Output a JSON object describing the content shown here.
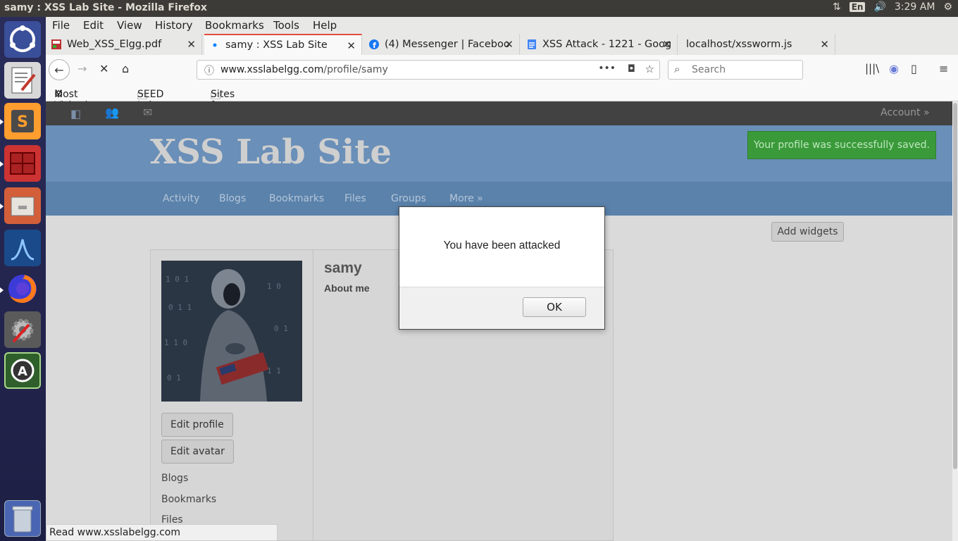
{
  "os": {
    "window_title": "samy : XSS Lab Site - Mozilla Firefox",
    "keyboard_layout": "En",
    "clock": "3:29 AM"
  },
  "menu": [
    "File",
    "Edit",
    "View",
    "History",
    "Bookmarks",
    "Tools",
    "Help"
  ],
  "tabs": [
    {
      "label": "Web_XSS_Elgg.pdf",
      "icon": "pdf-icon"
    },
    {
      "label": "samy : XSS Lab Site",
      "icon": "loading-dot-icon",
      "active": true
    },
    {
      "label": "(4) Messenger | Faceboo",
      "icon": "facebook-icon"
    },
    {
      "label": "XSS Attack - 1221 - Goog",
      "icon": "google-docs-icon"
    },
    {
      "label": "localhost/xssworm.js",
      "icon": ""
    }
  ],
  "navbar": {
    "url_host": "www.xsslabelgg.com",
    "url_path": "/profile/samy",
    "search_placeholder": "Search"
  },
  "bookmarks": [
    "Most Visited",
    "SEED Labs",
    "Sites for Labs"
  ],
  "site": {
    "account_label": "Account »",
    "name": "XSS Lab Site",
    "success_message": "Your profile was successfully saved.",
    "nav": [
      "Activity",
      "Blogs",
      "Bookmarks",
      "Files",
      "Groups",
      "More »"
    ],
    "add_widgets": "Add widgets",
    "profile": {
      "username": "samy",
      "about_heading": "About me",
      "edit_profile": "Edit profile",
      "edit_avatar": "Edit avatar",
      "links": [
        "Blogs",
        "Bookmarks",
        "Files"
      ]
    }
  },
  "status_text": "Read www.xsslabelgg.com",
  "alert": {
    "message": "You have been attacked",
    "ok_label": "OK"
  },
  "colors": {
    "header_blue": "#6a8fb8",
    "nav_blue": "#5a82ab",
    "success_green": "#3a9a3a",
    "active_tab_accent": "#e34c3c"
  }
}
